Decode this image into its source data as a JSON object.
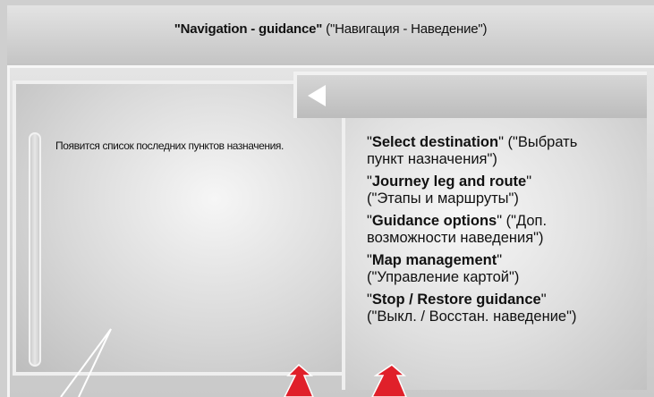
{
  "header": {
    "title_en": "Navigation - guidance",
    "title_ru": " (\"Навигация - Наведение\")"
  },
  "left_panel": {
    "text": "Появится список последних пунктов назначения."
  },
  "menu": {
    "items": [
      {
        "en": "Select destination",
        "ru1": " (\"Выбрать",
        "ru2": "пункт назначения\")"
      },
      {
        "en": "Journey leg and route",
        "ru1": "",
        "ru2": "(\"Этапы и маршруты\")"
      },
      {
        "en": "Guidance options",
        "ru1": " (\"Доп.",
        "ru2": "возможности наведения\")"
      },
      {
        "en": "Map management",
        "ru1": "",
        "ru2": "(\"Управление картой\")"
      },
      {
        "en": "Stop / Restore guidance",
        "ru1": "",
        "ru2": "(\"Выкл. / Восстан. наведение\")"
      }
    ]
  },
  "icons": {
    "back": "back-arrow-icon",
    "pointers": "red-arrow-icon"
  },
  "colors": {
    "accent_arrow": "#e0202a",
    "text": "#111111"
  }
}
